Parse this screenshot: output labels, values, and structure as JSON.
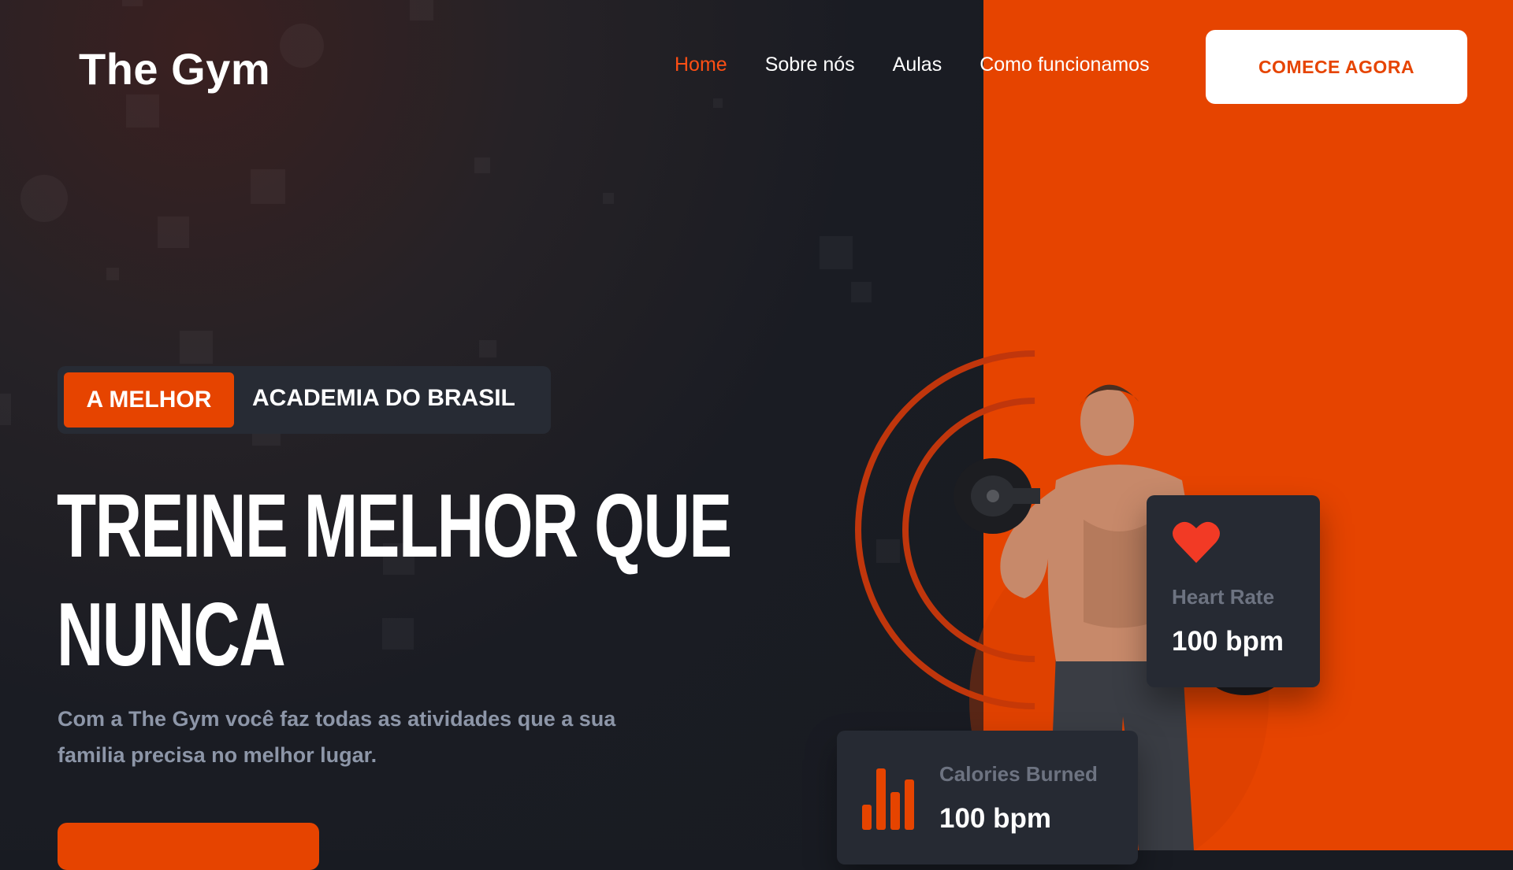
{
  "brand": {
    "name": "The Gym"
  },
  "nav": {
    "links": [
      {
        "label": "Home",
        "active": true
      },
      {
        "label": "Sobre nós",
        "active": false
      },
      {
        "label": "Aulas",
        "active": false
      },
      {
        "label": "Como funcionamos",
        "active": false
      }
    ],
    "cta_label": "COMECE AGORA"
  },
  "hero": {
    "badge": "A MELHOR",
    "badge_rest": "ACADEMIA DO BRASIL",
    "headline_line1": "TREINE MELHOR QUE",
    "headline_line2": "NUNCA",
    "subtitle": "Com a The Gym você faz todas as atividades que a sua familia precisa no melhor lugar."
  },
  "stats": {
    "heart": {
      "label": "Heart Rate",
      "value": "100 bpm",
      "icon": "heart-icon"
    },
    "calories": {
      "label": "Calories Burned",
      "value": "100 bpm",
      "icon": "bar-chart-icon"
    }
  },
  "colors": {
    "accent": "#e64400",
    "dark_bg": "#181b22",
    "card_bg": "#262a33"
  }
}
